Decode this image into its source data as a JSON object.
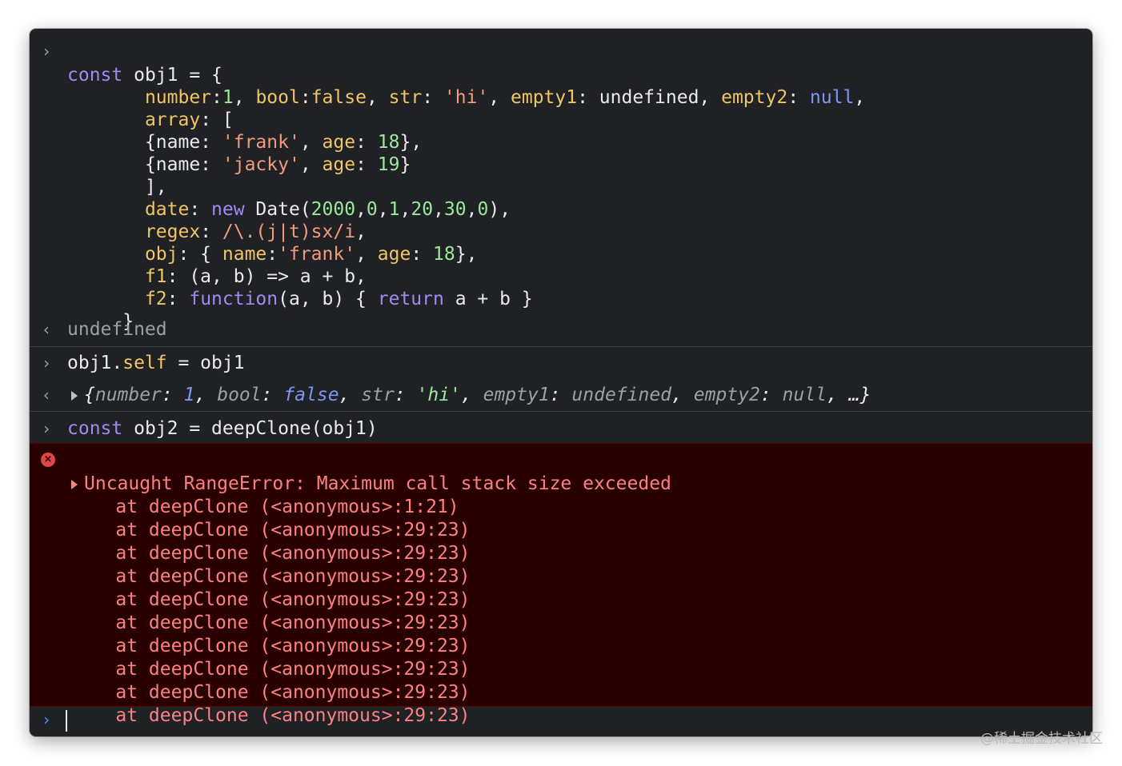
{
  "console": {
    "input1": {
      "lines": [
        [
          "const",
          " obj1 = {"
        ],
        [
          "number",
          ":",
          "1",
          ", ",
          "bool",
          ":",
          "false",
          ", ",
          "str",
          ": ",
          "'hi'",
          ", ",
          "empty1",
          ": undefined, ",
          "empty2",
          ": ",
          "null",
          ","
        ],
        [
          "array",
          ": ["
        ],
        [
          "{name: ",
          "'frank'",
          ", ",
          "age",
          ": ",
          "18",
          "},"
        ],
        [
          "{name: ",
          "'jacky'",
          ", ",
          "age",
          ": ",
          "19",
          "}"
        ],
        [
          "],"
        ],
        [
          "date",
          ": ",
          "new",
          " Date(",
          "2000",
          ",",
          "0",
          ",",
          "1",
          ",",
          "20",
          ",",
          "30",
          ",",
          "0",
          "),"
        ],
        [
          "regex",
          ": ",
          "/\\.(j|t)sx/i",
          ","
        ],
        [
          "obj",
          ": { ",
          "name",
          ":",
          "'frank'",
          ", ",
          "age",
          ": ",
          "18",
          "},"
        ],
        [
          "f1",
          ": (a, b) => a + b,"
        ],
        [
          "f2",
          ": ",
          "function",
          "(a, b) { ",
          "return",
          " a + b }"
        ],
        [
          "}"
        ]
      ],
      "result": "undefined"
    },
    "input2": {
      "text_a": "obj1.",
      "text_b": "self",
      "text_c": " = obj1",
      "result_preview": [
        "{",
        "number",
        ": ",
        "1",
        ", ",
        "bool",
        ": ",
        "false",
        ", ",
        "str",
        ": ",
        "'hi'",
        ", ",
        "empty1",
        ": ",
        "undefined",
        ", ",
        "empty2",
        ": ",
        "null",
        ", …}"
      ]
    },
    "input3": {
      "kw": "const",
      "rest": " obj2 = deepClone(obj1)"
    },
    "error": {
      "message": "Uncaught RangeError: Maximum call stack size exceeded",
      "stack": [
        "    at deepClone (<anonymous>:1:21)",
        "    at deepClone (<anonymous>:29:23)",
        "    at deepClone (<anonymous>:29:23)",
        "    at deepClone (<anonymous>:29:23)",
        "    at deepClone (<anonymous>:29:23)",
        "    at deepClone (<anonymous>:29:23)",
        "    at deepClone (<anonymous>:29:23)",
        "    at deepClone (<anonymous>:29:23)",
        "    at deepClone (<anonymous>:29:23)",
        "    at deepClone (<anonymous>:29:23)"
      ]
    },
    "prompt_input": ""
  },
  "glyphs": {
    "input_prompt": "›",
    "output_prompt": "‹",
    "error_x": "×"
  },
  "watermark": "@稀土掘金技术社区"
}
